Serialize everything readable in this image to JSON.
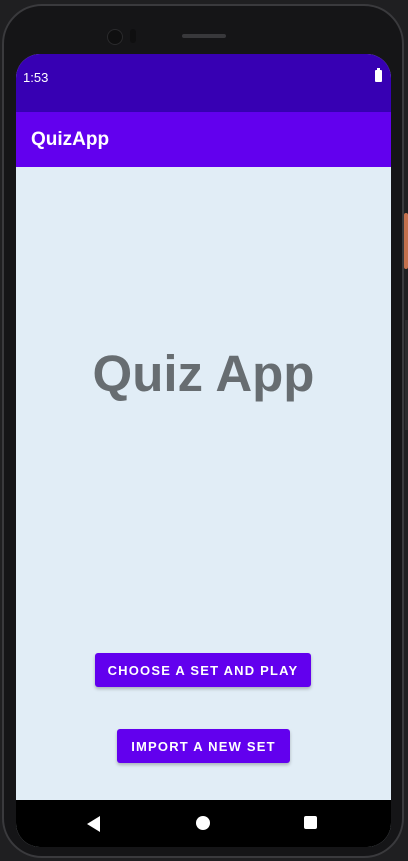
{
  "status_bar": {
    "time": "1:53",
    "battery_icon": "battery-full-icon",
    "color": "#3700b3"
  },
  "app_bar": {
    "title": "QuizApp",
    "color": "#6200ee"
  },
  "main": {
    "hero_title": "Quiz App",
    "background": "#e1edf6",
    "buttons": {
      "choose_set": "CHOOSE A SET AND PLAY",
      "import_set": "IMPORT A NEW SET"
    }
  },
  "navigation": {
    "back_icon": "back-triangle-icon",
    "home_icon": "home-circle-icon",
    "recents_icon": "recents-square-icon"
  }
}
